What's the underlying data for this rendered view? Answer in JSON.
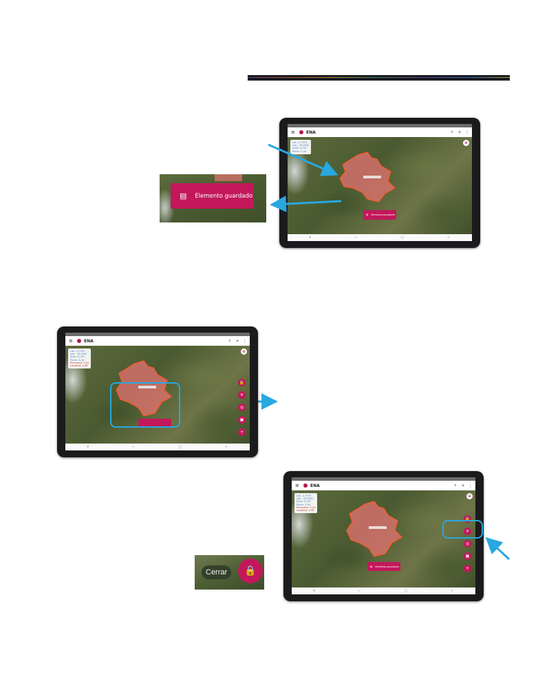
{
  "app": {
    "title": "ENA",
    "icons": {
      "menu": "menu-icon",
      "search": "search-icon",
      "add": "add-icon",
      "more": "more-vert-icon",
      "locate": "gps-crosshair-icon"
    }
  },
  "infobox_lines": [
    "Lat: -2.7375",
    "Lon: -79.0052",
    "Área: 47,53",
    "Perím: 3,44",
    "Área: 478.87",
    "Perímetro: 3.44",
    "Longitud: 4.98"
  ],
  "toast": {
    "icon": "message-icon",
    "text": "Elemento guardado"
  },
  "close_popup": {
    "tooltip": "Cerrar",
    "icon": "lock-icon"
  },
  "fab_buttons": [
    {
      "icon": "lock-icon",
      "glyph": "🔒"
    },
    {
      "icon": "close-icon",
      "glyph": "✕"
    },
    {
      "icon": "layers-icon",
      "glyph": "◎"
    },
    {
      "icon": "save-icon",
      "glyph": "▣"
    },
    {
      "icon": "add-icon",
      "glyph": "+"
    }
  ],
  "nav_glyphs": [
    "▾",
    "⌐",
    "□",
    "←"
  ],
  "colors": {
    "accent": "#c2185b",
    "polygon_fill": "#e57373",
    "polygon_stroke": "#ff5722",
    "callout": "#29a8e0"
  }
}
